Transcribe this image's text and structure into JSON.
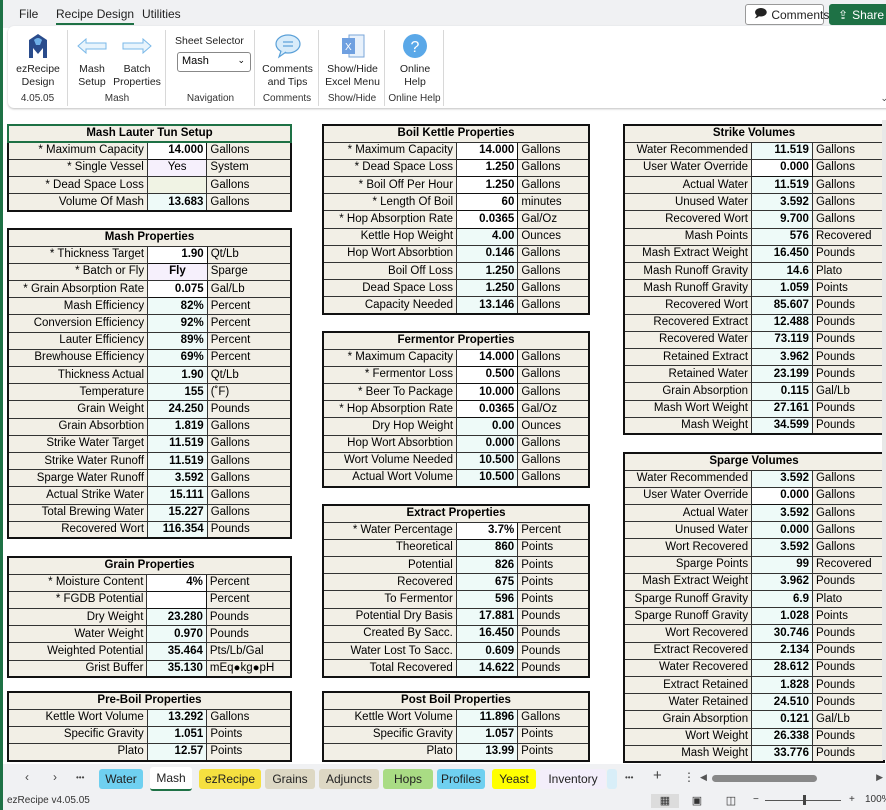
{
  "menubar": {
    "items": [
      "File",
      "Recipe Design",
      "Utilities"
    ],
    "active": "Recipe Design",
    "comments_button": "Comments",
    "share_button": "Share"
  },
  "ribbon": {
    "groups": [
      {
        "label": "4.05.05",
        "buttons": [
          {
            "line1": "ezRecipe",
            "line2": "Design",
            "icon": "ezrecipe-logo-icon"
          }
        ]
      },
      {
        "label": "Mash",
        "buttons": [
          {
            "line1": "Mash",
            "line2": "Setup",
            "icon": "arrow-left-icon"
          },
          {
            "line1": "Batch",
            "line2": "Properties",
            "icon": "arrow-right-icon"
          }
        ]
      },
      {
        "label": "Navigation",
        "sheet_selector_label": "Sheet Selector",
        "sheet_selector_value": "Mash"
      },
      {
        "label": "Comments",
        "buttons": [
          {
            "line1": "Comments",
            "line2": "and Tips",
            "icon": "speech-bubble-icon"
          }
        ]
      },
      {
        "label": "Show/Hide",
        "buttons": [
          {
            "line1": "Show/Hide",
            "line2": "Excel Menu",
            "icon": "excel-icon"
          }
        ]
      },
      {
        "label": "Online Help",
        "buttons": [
          {
            "line1": "Online",
            "line2": "Help",
            "icon": "help-icon"
          }
        ]
      }
    ]
  },
  "tables": {
    "mash_lauter": {
      "title": "Mash Lauter Tun Setup",
      "rows": [
        {
          "label": "* Maximum Capacity",
          "value": "14.000",
          "unit": "Gallons",
          "kind": "inp"
        },
        {
          "label": "* Single Vessel",
          "value": "Yes",
          "unit": "System",
          "kind": "opt"
        },
        {
          "label": "* Dead Space Loss",
          "value": "",
          "unit": "Gallons",
          "kind": "empty"
        },
        {
          "label": "Volume Of Mash",
          "value": "13.683",
          "unit": "Gallons",
          "kind": "calc"
        }
      ]
    },
    "mash_props": {
      "title": "Mash Properties",
      "rows": [
        {
          "label": "* Thickness Target",
          "value": "1.90",
          "unit": "Qt/Lb",
          "kind": "inp"
        },
        {
          "label": "* Batch or Fly",
          "value": "Fly",
          "unit": "Sparge",
          "kind": "opt"
        },
        {
          "label": "* Grain Absorption Rate",
          "value": "0.075",
          "unit": "Gal/Lb",
          "kind": "inp"
        },
        {
          "label": "Mash Efficiency",
          "value": "82%",
          "unit": "Percent",
          "kind": "calc"
        },
        {
          "label": "Conversion Efficiency",
          "value": "92%",
          "unit": "Percent",
          "kind": "calc"
        },
        {
          "label": "Lauter Efficiency",
          "value": "89%",
          "unit": "Percent",
          "kind": "calc"
        },
        {
          "label": "Brewhouse Efficiency",
          "value": "69%",
          "unit": "Percent",
          "kind": "calc"
        },
        {
          "label": "Thickness Actual",
          "value": "1.90",
          "unit": "Qt/Lb",
          "kind": "calc"
        },
        {
          "label": "Temperature",
          "value": "155",
          "unit": "(˚F)",
          "kind": "calc"
        },
        {
          "label": "Grain Weight",
          "value": "24.250",
          "unit": "Pounds",
          "kind": "calc"
        },
        {
          "label": "Grain Absorbtion",
          "value": "1.819",
          "unit": "Gallons",
          "kind": "calc"
        },
        {
          "label": "Strike Water Target",
          "value": "11.519",
          "unit": "Gallons",
          "kind": "calc"
        },
        {
          "label": "Strike Water Runoff",
          "value": "11.519",
          "unit": "Gallons",
          "kind": "calc"
        },
        {
          "label": "Sparge Water Runoff",
          "value": "3.592",
          "unit": "Gallons",
          "kind": "calc"
        },
        {
          "label": "Actual Strike Water",
          "value": "15.111",
          "unit": "Gallons",
          "kind": "calc"
        },
        {
          "label": "Total Brewing Water",
          "value": "15.227",
          "unit": "Gallons",
          "kind": "calc"
        },
        {
          "label": "Recovered Wort",
          "value": "116.354",
          "unit": "Pounds",
          "kind": "calc"
        }
      ]
    },
    "grain_props": {
      "title": "Grain Properties",
      "rows": [
        {
          "label": "* Moisture Content",
          "value": "4%",
          "unit": "Percent",
          "kind": "inp"
        },
        {
          "label": "* FGDB Potential",
          "value": "",
          "unit": "Percent",
          "kind": "inp"
        },
        {
          "label": "Dry Weight",
          "value": "23.280",
          "unit": "Pounds",
          "kind": "calc"
        },
        {
          "label": "Water Weight",
          "value": "0.970",
          "unit": "Pounds",
          "kind": "calc"
        },
        {
          "label": "Weighted Potential",
          "value": "35.464",
          "unit": "Pts/Lb/Gal",
          "kind": "calc"
        },
        {
          "label": "Grist Buffer",
          "value": "35.130",
          "unit": "mEq●kg●pH",
          "kind": "calc"
        }
      ]
    },
    "preboil": {
      "title": "Pre-Boil Properties",
      "rows": [
        {
          "label": "Kettle Wort Volume",
          "value": "13.292",
          "unit": "Gallons",
          "kind": "calc"
        },
        {
          "label": "Specific Gravity",
          "value": "1.051",
          "unit": "Points",
          "kind": "calc"
        },
        {
          "label": "Plato",
          "value": "12.57",
          "unit": "Points",
          "kind": "calc"
        }
      ]
    },
    "boil_kettle": {
      "title": "Boil Kettle Properties",
      "rows": [
        {
          "label": "* Maximum Capacity",
          "value": "14.000",
          "unit": "Gallons",
          "kind": "inp"
        },
        {
          "label": "* Dead Space Loss",
          "value": "1.250",
          "unit": "Gallons",
          "kind": "inp"
        },
        {
          "label": "* Boil Off Per Hour",
          "value": "1.250",
          "unit": "Gallons",
          "kind": "inp"
        },
        {
          "label": "* Length Of Boil",
          "value": "60",
          "unit": "minutes",
          "kind": "inp"
        },
        {
          "label": "* Hop Absorption Rate",
          "value": "0.0365",
          "unit": "Gal/Oz",
          "kind": "inp"
        },
        {
          "label": "Kettle Hop Weight",
          "value": "4.00",
          "unit": "Ounces",
          "kind": "calc"
        },
        {
          "label": "Hop Wort Absorbtion",
          "value": "0.146",
          "unit": "Gallons",
          "kind": "calc"
        },
        {
          "label": "Boil Off Loss",
          "value": "1.250",
          "unit": "Gallons",
          "kind": "calc"
        },
        {
          "label": "Dead Space Loss",
          "value": "1.250",
          "unit": "Gallons",
          "kind": "calc"
        },
        {
          "label": "Capacity Needed",
          "value": "13.146",
          "unit": "Gallons",
          "kind": "calc"
        }
      ]
    },
    "fermentor": {
      "title": "Fermentor Properties",
      "rows": [
        {
          "label": "* Maximum Capacity",
          "value": "14.000",
          "unit": "Gallons",
          "kind": "inp"
        },
        {
          "label": "* Fermentor Loss",
          "value": "0.500",
          "unit": "Gallons",
          "kind": "inp"
        },
        {
          "label": "* Beer To Package",
          "value": "10.000",
          "unit": "Gallons",
          "kind": "inp"
        },
        {
          "label": "* Hop Absorption Rate",
          "value": "0.0365",
          "unit": "Gal/Oz",
          "kind": "inp"
        },
        {
          "label": "Dry Hop Weight",
          "value": "0.00",
          "unit": "Ounces",
          "kind": "calc"
        },
        {
          "label": "Hop Wort Absorbtion",
          "value": "0.000",
          "unit": "Gallons",
          "kind": "calc"
        },
        {
          "label": "Wort Volume Needed",
          "value": "10.500",
          "unit": "Gallons",
          "kind": "calc"
        },
        {
          "label": "Actual Wort Volume",
          "value": "10.500",
          "unit": "Gallons",
          "kind": "calc"
        }
      ]
    },
    "extract": {
      "title": "Extract Properties",
      "rows": [
        {
          "label": "* Water Percentage",
          "value": "3.7%",
          "unit": "Percent",
          "kind": "inp"
        },
        {
          "label": "Theoretical",
          "value": "860",
          "unit": "Points",
          "kind": "calc"
        },
        {
          "label": "Potential",
          "value": "826",
          "unit": "Points",
          "kind": "calc"
        },
        {
          "label": "Recovered",
          "value": "675",
          "unit": "Points",
          "kind": "calc"
        },
        {
          "label": "To Fermentor",
          "value": "596",
          "unit": "Points",
          "kind": "calc"
        },
        {
          "label": "Potential Dry Basis",
          "value": "17.881",
          "unit": "Pounds",
          "kind": "calc"
        },
        {
          "label": "Created By Sacc.",
          "value": "16.450",
          "unit": "Pounds",
          "kind": "calc"
        },
        {
          "label": "Water Lost To Sacc.",
          "value": "0.609",
          "unit": "Pounds",
          "kind": "calc"
        },
        {
          "label": "Total Recovered",
          "value": "14.622",
          "unit": "Pounds",
          "kind": "calc"
        }
      ]
    },
    "postboil": {
      "title": "Post Boil Properties",
      "rows": [
        {
          "label": "Kettle Wort Volume",
          "value": "11.896",
          "unit": "Gallons",
          "kind": "calc"
        },
        {
          "label": "Specific Gravity",
          "value": "1.057",
          "unit": "Points",
          "kind": "calc"
        },
        {
          "label": "Plato",
          "value": "13.99",
          "unit": "Points",
          "kind": "calc"
        }
      ]
    },
    "strike": {
      "title": "Strike Volumes",
      "rows": [
        {
          "label": "Water Recommended",
          "value": "11.519",
          "unit": "Gallons",
          "kind": "calc"
        },
        {
          "label": "User Water Override",
          "value": "0.000",
          "unit": "Gallons",
          "kind": "inp"
        },
        {
          "label": "Actual Water",
          "value": "11.519",
          "unit": "Gallons",
          "kind": "calc"
        },
        {
          "label": "Unused Water",
          "value": "3.592",
          "unit": "Gallons",
          "kind": "calc"
        },
        {
          "label": "Recovered Wort",
          "value": "9.700",
          "unit": "Gallons",
          "kind": "calc"
        },
        {
          "label": "Mash Points",
          "value": "576",
          "unit": "Recovered",
          "kind": "calc"
        },
        {
          "label": "Mash Extract Weight",
          "value": "16.450",
          "unit": "Pounds",
          "kind": "calc"
        },
        {
          "label": "Mash Runoff Gravity",
          "value": "14.6",
          "unit": "Plato",
          "kind": "calc"
        },
        {
          "label": "Mash Runoff Gravity",
          "value": "1.059",
          "unit": "Points",
          "kind": "calc"
        },
        {
          "label": "Recovered Wort",
          "value": "85.607",
          "unit": "Pounds",
          "kind": "calc"
        },
        {
          "label": "Recovered Extract",
          "value": "12.488",
          "unit": "Pounds",
          "kind": "calc"
        },
        {
          "label": "Recovered Water",
          "value": "73.119",
          "unit": "Pounds",
          "kind": "calc"
        },
        {
          "label": "Retained Extract",
          "value": "3.962",
          "unit": "Pounds",
          "kind": "calc"
        },
        {
          "label": "Retained Water",
          "value": "23.199",
          "unit": "Pounds",
          "kind": "calc"
        },
        {
          "label": "Grain Absorption",
          "value": "0.115",
          "unit": "Gal/Lb",
          "kind": "calc"
        },
        {
          "label": "Mash Wort Weight",
          "value": "27.161",
          "unit": "Pounds",
          "kind": "calc"
        },
        {
          "label": "Mash Weight",
          "value": "34.599",
          "unit": "Pounds",
          "kind": "calc"
        }
      ]
    },
    "sparge": {
      "title": "Sparge Volumes",
      "rows": [
        {
          "label": "Water  Recommended",
          "value": "3.592",
          "unit": "Gallons",
          "kind": "calc"
        },
        {
          "label": "User Water Override",
          "value": "0.000",
          "unit": "Gallons",
          "kind": "inp"
        },
        {
          "label": "Actual Water",
          "value": "3.592",
          "unit": "Gallons",
          "kind": "calc"
        },
        {
          "label": "Unused Water",
          "value": "0.000",
          "unit": "Gallons",
          "kind": "calc"
        },
        {
          "label": "Wort Recovered",
          "value": "3.592",
          "unit": "Gallons",
          "kind": "calc"
        },
        {
          "label": "Sparge Points",
          "value": "99",
          "unit": "Recovered",
          "kind": "calc"
        },
        {
          "label": "Mash Extract Weight",
          "value": "3.962",
          "unit": "Pounds",
          "kind": "calc"
        },
        {
          "label": "Sparge Runoff Gravity",
          "value": "6.9",
          "unit": "Plato",
          "kind": "calc"
        },
        {
          "label": "Sparge Runoff Gravity",
          "value": "1.028",
          "unit": "Points",
          "kind": "calc"
        },
        {
          "label": "Wort Recovered",
          "value": "30.746",
          "unit": "Pounds",
          "kind": "calc"
        },
        {
          "label": "Extract Recovered",
          "value": "2.134",
          "unit": "Pounds",
          "kind": "calc"
        },
        {
          "label": "Water Recovered",
          "value": "28.612",
          "unit": "Pounds",
          "kind": "calc"
        },
        {
          "label": "Extract Retained",
          "value": "1.828",
          "unit": "Pounds",
          "kind": "calc"
        },
        {
          "label": "Water Retained",
          "value": "24.510",
          "unit": "Pounds",
          "kind": "calc"
        },
        {
          "label": "Grain Absorption",
          "value": "0.121",
          "unit": "Gal/Lb",
          "kind": "calc"
        },
        {
          "label": "Wort Weight",
          "value": "26.338",
          "unit": "Pounds",
          "kind": "calc"
        },
        {
          "label": "Mash Weight",
          "value": "33.776",
          "unit": "Pounds",
          "kind": "calc"
        }
      ]
    }
  },
  "sheet_tabs": [
    {
      "label": "Water",
      "color": "#6fd0f0"
    },
    {
      "label": "Mash",
      "color": "#ffffff",
      "active": true
    },
    {
      "label": "ezRecipe",
      "color": "#f5e040"
    },
    {
      "label": "Grains",
      "color": "#ddd8c4"
    },
    {
      "label": "Adjuncts",
      "color": "#ddd8c4"
    },
    {
      "label": "Hops",
      "color": "#a9dc84"
    },
    {
      "label": "Profiles",
      "color": "#6fd0f0"
    },
    {
      "label": "Yeast",
      "color": "#ffff00"
    },
    {
      "label": "Inventory",
      "color": "#f3eefa"
    }
  ],
  "tab_nav": {
    "prev": "‹",
    "next": "›",
    "more": "•••",
    "add": "+",
    "options": "⋮"
  },
  "statusbar": {
    "text": "ezRecipe v4.05.05",
    "zoom": "100%",
    "zoom_minus": "−",
    "zoom_plus": "+"
  },
  "colors": {
    "accent": "#1e7145",
    "label_bg": "#f2efe6",
    "calc_bg": "#eefaf8",
    "option_bg": "#f6f0fc"
  }
}
